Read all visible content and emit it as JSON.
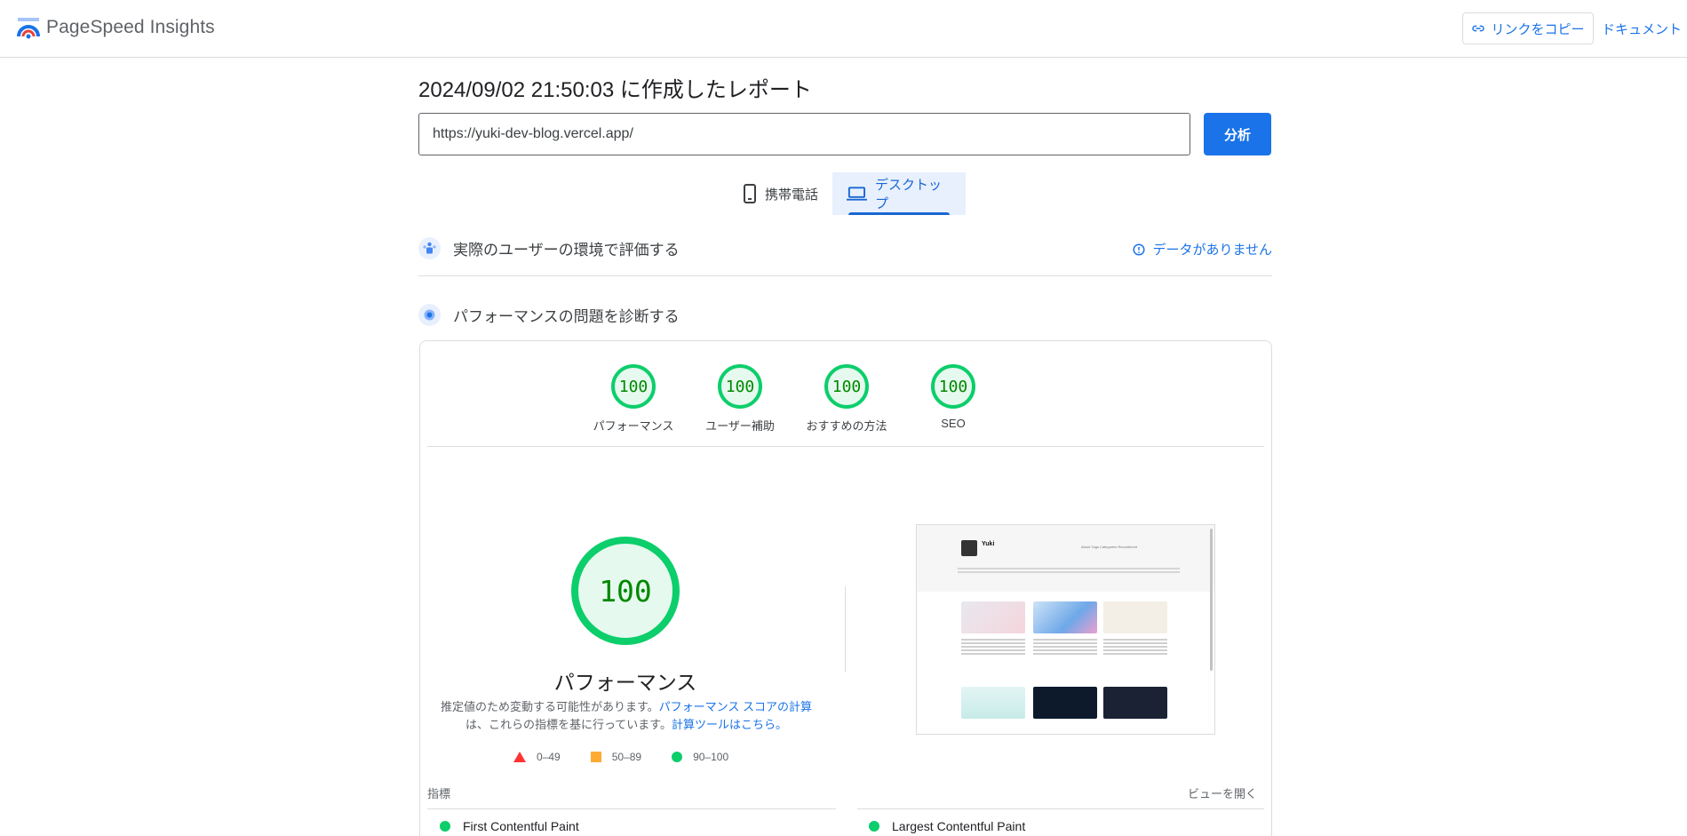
{
  "header": {
    "app_title": "PageSpeed Insights",
    "copy_link_label": "リンクをコピー",
    "docs_label": "ドキュメント"
  },
  "report": {
    "title": "2024/09/02 21:50:03 に作成したレポート",
    "url_value": "https://yuki-dev-blog.vercel.app/",
    "analyze_label": "分析"
  },
  "tabs": [
    {
      "label": "携帯電話",
      "icon": "smartphone-icon",
      "selected": false
    },
    {
      "label": "デスクトップ",
      "icon": "laptop-icon",
      "selected": true
    }
  ],
  "field_data": {
    "title": "実際のユーザーの環境で評価する",
    "status": "データがありません",
    "status_icon": "info-icon"
  },
  "lab_data": {
    "title": "パフォーマンスの問題を診断する"
  },
  "scores": [
    {
      "value": "100",
      "label": "パフォーマンス"
    },
    {
      "value": "100",
      "label": "ユーザー補助"
    },
    {
      "value": "100",
      "label": "おすすめの方法"
    },
    {
      "value": "100",
      "label": "SEO"
    }
  ],
  "performance": {
    "score": "100",
    "label": "パフォーマンス",
    "desc_part1": "推定値のため変動する可能性があります。",
    "desc_link1": "パフォーマンス スコアの計算",
    "desc_part2": "は、これらの指標を基に行っています。",
    "desc_link2": "計算ツールはこちら。"
  },
  "legend": [
    {
      "range": "0–49",
      "shape": "triangle",
      "color": "#ff3333"
    },
    {
      "range": "50–89",
      "shape": "square",
      "color": "#ffaa33"
    },
    {
      "range": "90–100",
      "shape": "circle",
      "color": "#0cce6b"
    }
  ],
  "preview": {
    "site_name": "Yuki",
    "nav": "About   Tags   Categories   Recruitment"
  },
  "metrics": {
    "heading": "指標",
    "expand_label": "ビューを開く",
    "items": [
      {
        "name": "First Contentful Paint",
        "status_color": "#0cce6b"
      },
      {
        "name": "Largest Contentful Paint",
        "status_color": "#0cce6b"
      }
    ]
  },
  "colors": {
    "accent": "#1a73e8",
    "pass": "#0cce6b",
    "pass_text": "#008800"
  }
}
